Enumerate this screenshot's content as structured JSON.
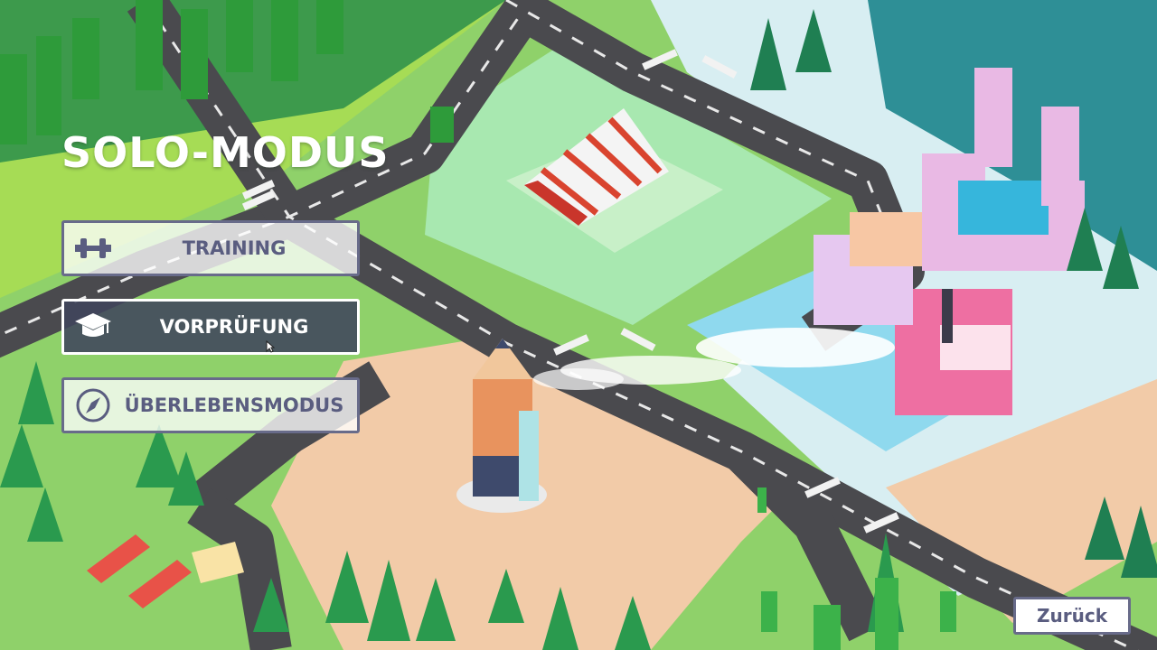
{
  "screen": {
    "title": "SOLO-MODUS",
    "menu": [
      {
        "id": "training",
        "label": "TRAINING",
        "icon": "dumbbell-icon",
        "selected": false
      },
      {
        "id": "vorpruefung",
        "label": "VORPRÜFUNG",
        "icon": "graduation-cap-icon",
        "selected": true
      },
      {
        "id": "ueberleben",
        "label": "ÜBERLEBENSMODUS",
        "icon": "compass-icon",
        "selected": false
      }
    ],
    "back_label": "Zurück"
  },
  "colors": {
    "button_border": "#686b8a",
    "button_text": "#5a5d80",
    "selected_bg": "#40445c",
    "road": "#4a4a4e",
    "grass": "#8fd16a"
  }
}
